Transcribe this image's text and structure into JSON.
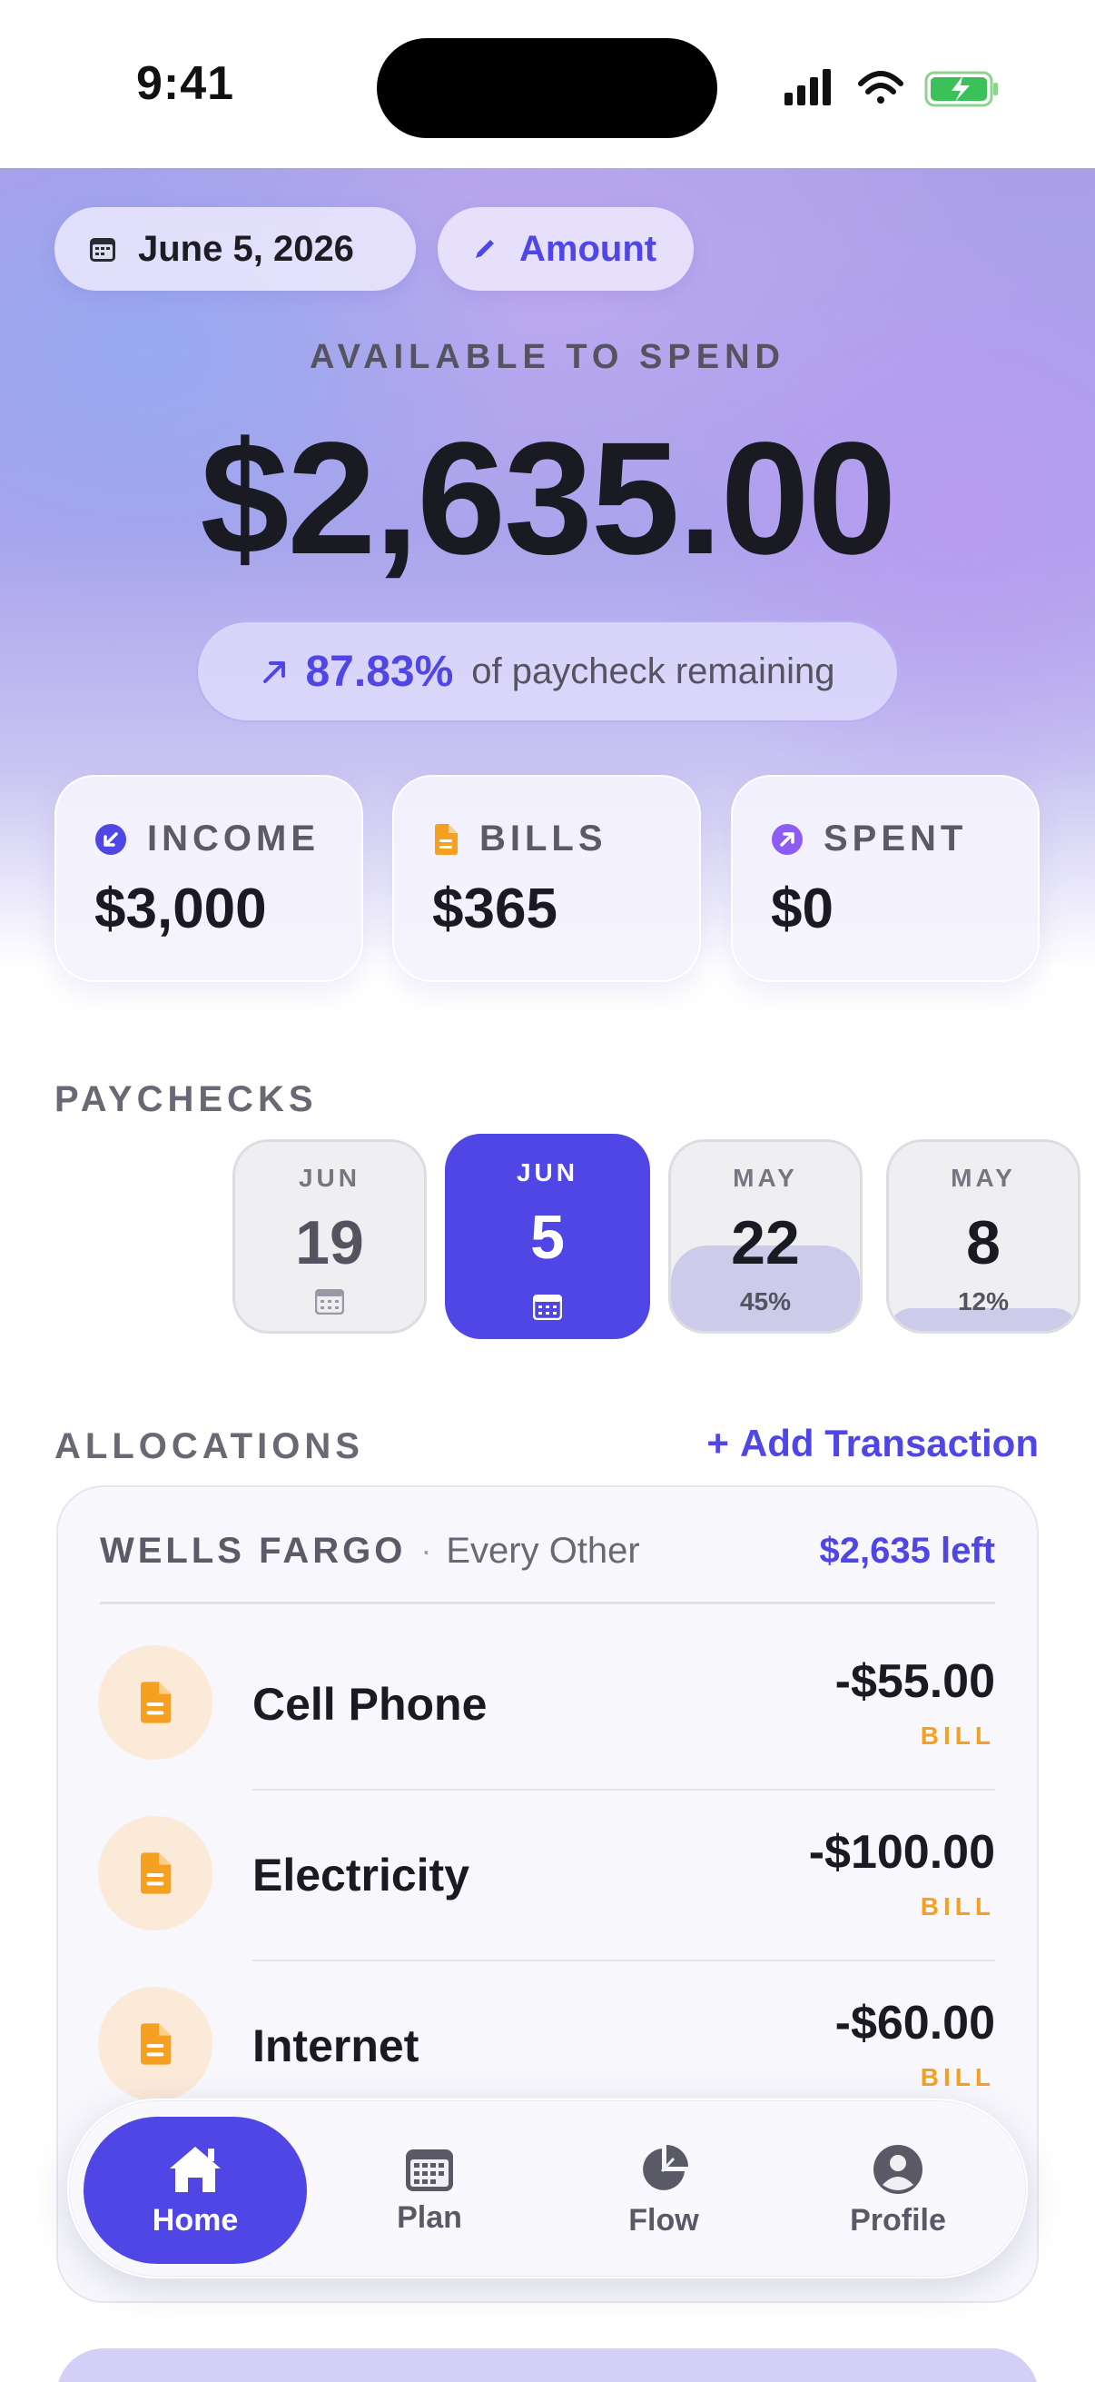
{
  "status_bar": {
    "time": "9:41"
  },
  "header": {
    "date_chip": "June 5, 2026",
    "amount_chip": "Amount",
    "available_label": "AVAILABLE TO SPEND",
    "available_amount": "$2,635.00",
    "remaining_pct": "87.83%",
    "remaining_text": "of paycheck remaining"
  },
  "stats": [
    {
      "label": "INCOME",
      "value": "$3,000",
      "icon": "arrow-down-left-icon",
      "color": "#4f46e5"
    },
    {
      "label": "BILLS",
      "value": "$365",
      "icon": "document-icon",
      "color": "#f5a020"
    },
    {
      "label": "SPENT",
      "value": "$0",
      "icon": "arrow-up-right-icon",
      "color": "#8b5cf6"
    }
  ],
  "paychecks": {
    "label": "PAYCHECKS",
    "items": [
      {
        "month": "JUN",
        "day": "19",
        "status": "upcoming"
      },
      {
        "month": "JUN",
        "day": "5",
        "status": "selected"
      },
      {
        "month": "MAY",
        "day": "22",
        "percent": "45%",
        "fill": 0.45
      },
      {
        "month": "MAY",
        "day": "8",
        "percent": "12%",
        "fill": 0.12
      }
    ]
  },
  "allocations": {
    "label": "ALLOCATIONS",
    "add_transaction": "Add Transaction",
    "account": {
      "name": "WELLS FARGO",
      "frequency": "Every Other",
      "left": "$2,635 left"
    },
    "rows": [
      {
        "title": "Cell Phone",
        "amount": "-$55.00",
        "tag": "BILL"
      },
      {
        "title": "Electricity",
        "amount": "-$100.00",
        "tag": "BILL"
      },
      {
        "title": "Internet",
        "amount": "-$60.00",
        "tag": "BILL"
      }
    ]
  },
  "tabbar": {
    "home": "Home",
    "plan": "Plan",
    "flow": "Flow",
    "profile": "Profile"
  },
  "colors": {
    "accent": "#4f46e5",
    "bill": "#f5a020"
  }
}
